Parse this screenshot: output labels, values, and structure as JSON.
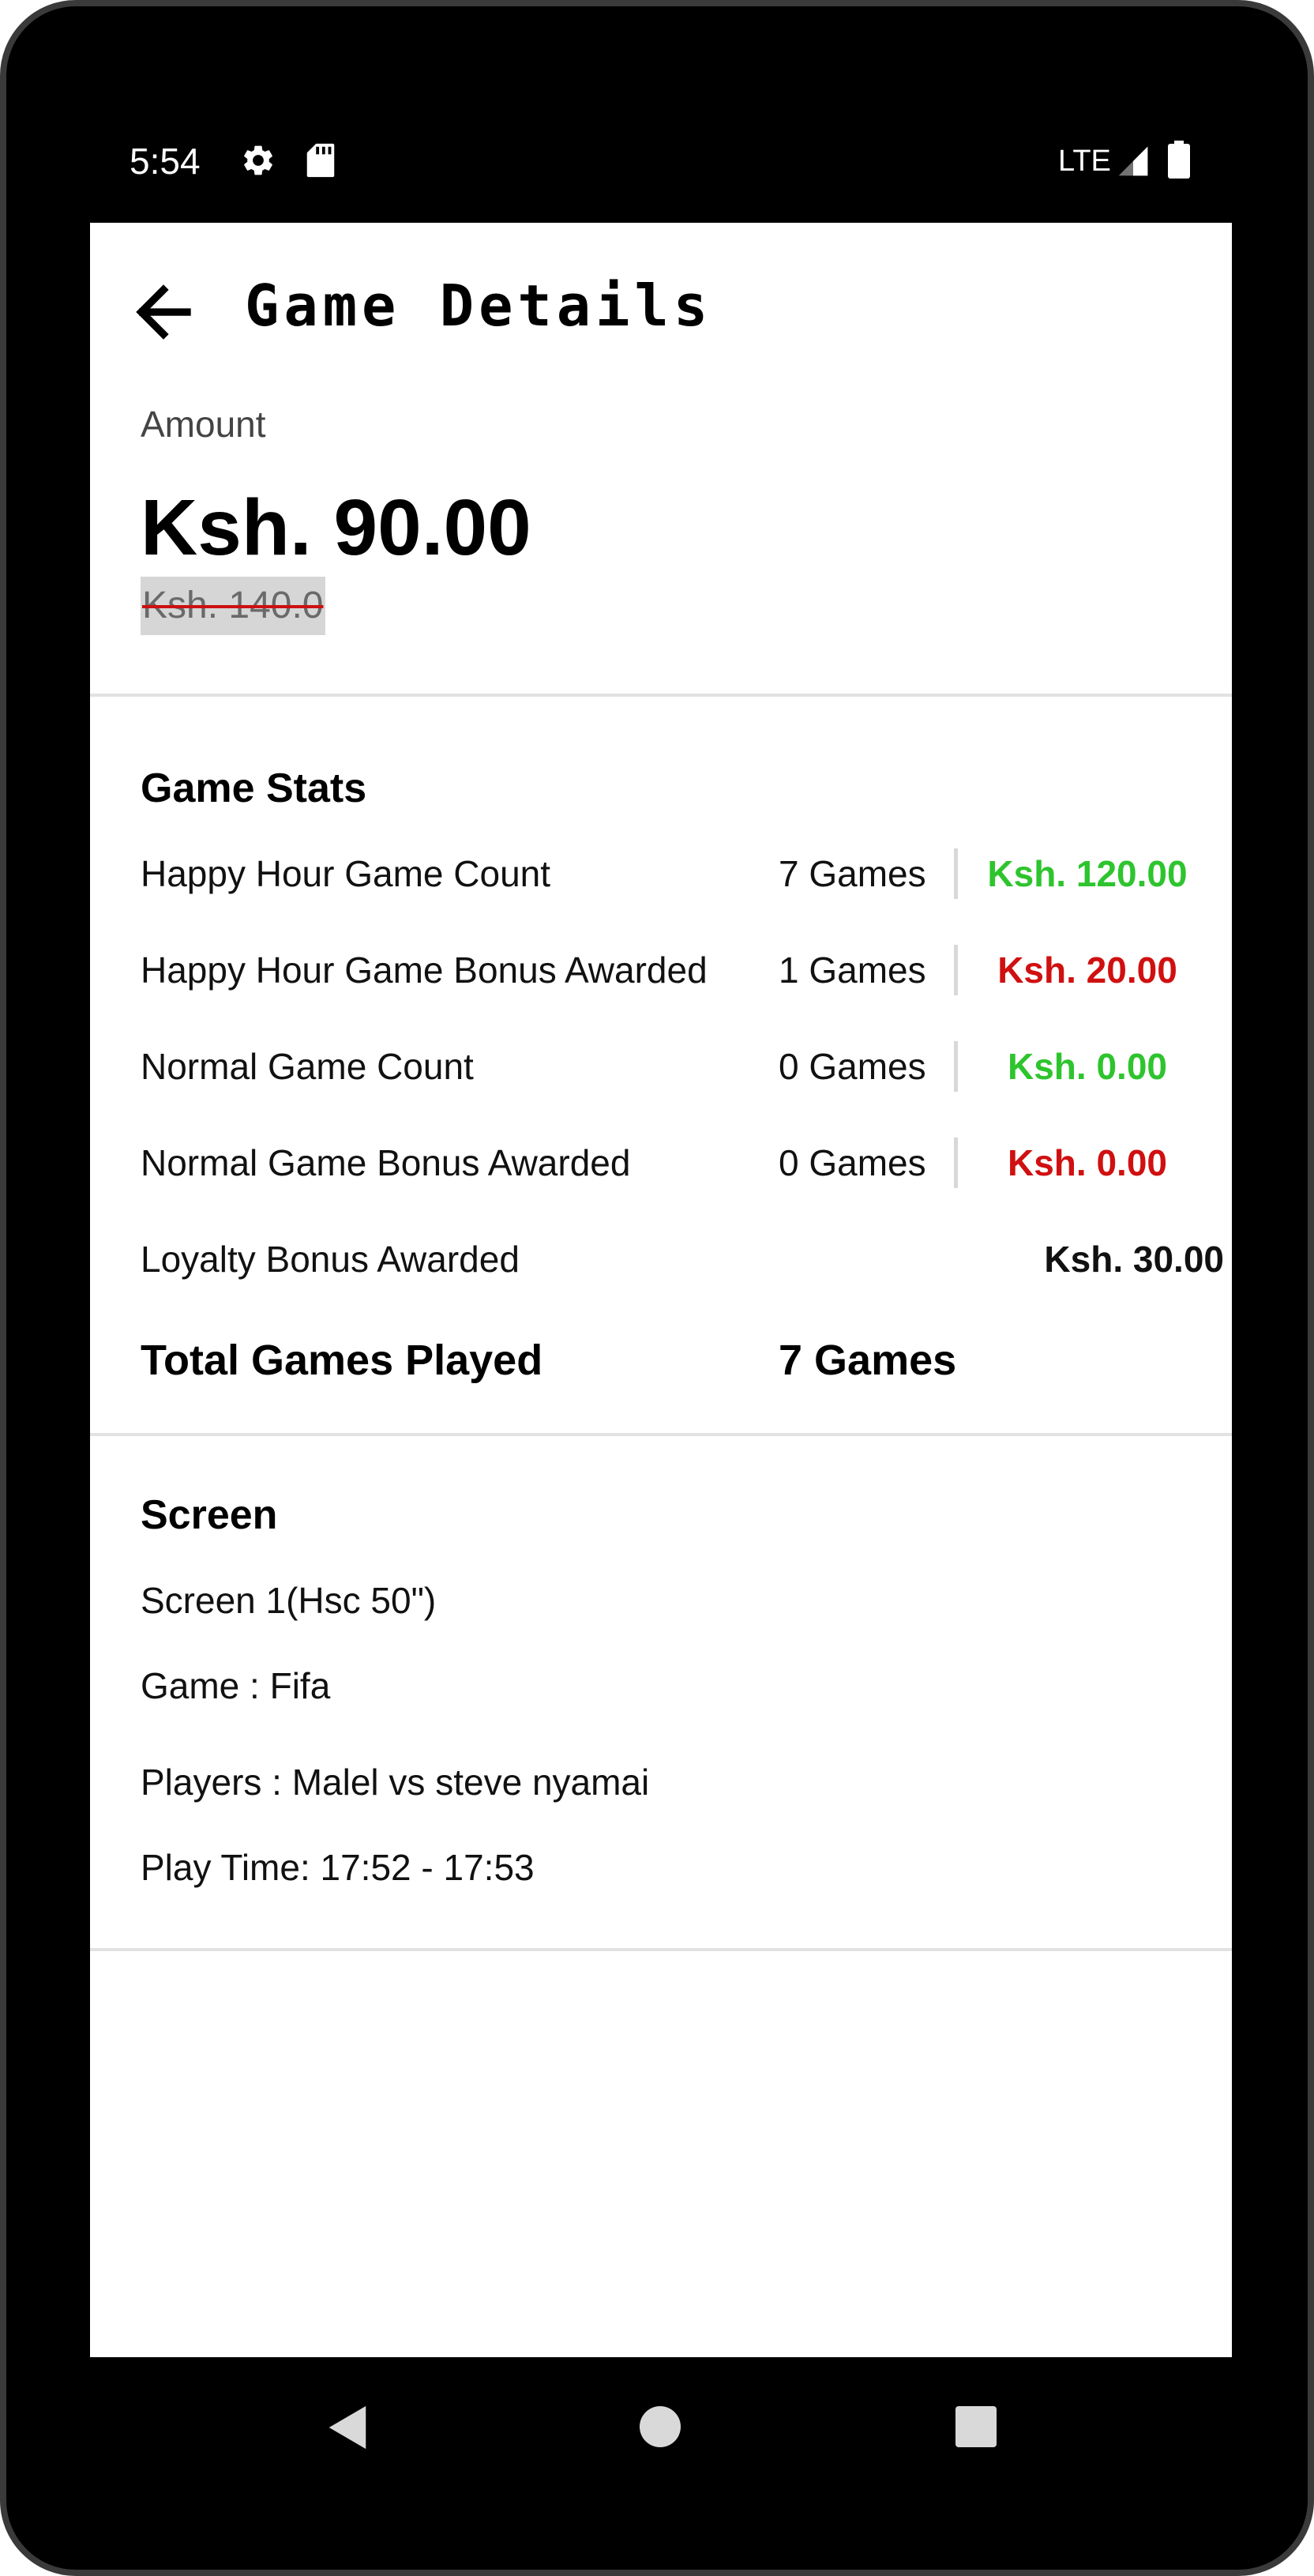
{
  "status_bar": {
    "time": "5:54",
    "network": "LTE",
    "icons": [
      "gear-icon",
      "sd-card-icon",
      "signal-icon",
      "battery-icon"
    ]
  },
  "app_bar": {
    "title": "Game Details",
    "back_icon": "arrow-left-icon"
  },
  "amount": {
    "label": "Amount",
    "value": "Ksh. 90.00",
    "original": "Ksh. 140.0"
  },
  "game_stats": {
    "title": "Game Stats",
    "rows": [
      {
        "label": "Happy Hour Game Count",
        "count": "7 Games",
        "amount": "Ksh. 120.00",
        "color": "#2ec42e"
      },
      {
        "label": "Happy Hour Game Bonus Awarded",
        "count": "1 Games",
        "amount": "Ksh. 20.00",
        "color": "#d01010"
      },
      {
        "label": "Normal Game Count",
        "count": "0 Games",
        "amount": "Ksh. 0.00",
        "color": "#2ec42e"
      },
      {
        "label": "Normal Game Bonus Awarded",
        "count": "0 Games",
        "amount": "Ksh. 0.00",
        "color": "#d01010"
      }
    ],
    "loyalty": {
      "label": "Loyalty Bonus Awarded",
      "amount": "Ksh. 30.00"
    },
    "total": {
      "label": "Total Games Played",
      "value": "7 Games"
    }
  },
  "screen_info": {
    "title": "Screen",
    "screen_name": "Screen 1(Hsc 50\")",
    "game": "Game : Fifa",
    "players": "Players : Malel vs steve nyamai",
    "play_time": "Play Time: 17:52 - 17:53"
  },
  "nav_bar": {
    "icons": [
      "nav-back-icon",
      "nav-home-icon",
      "nav-recents-icon"
    ]
  }
}
